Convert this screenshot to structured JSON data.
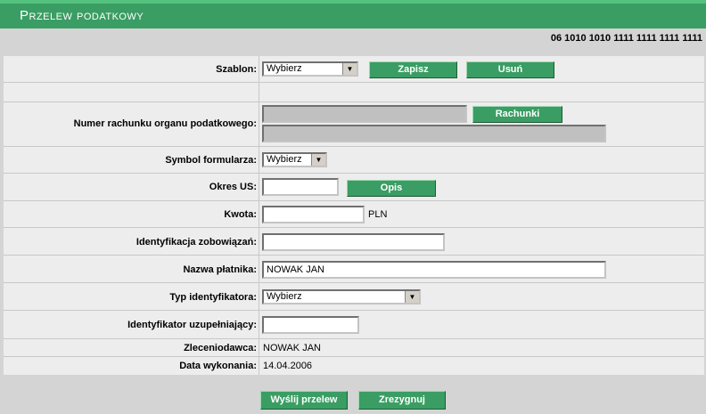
{
  "page_title": "Przelew podatkowy",
  "account_number": "06 1010 1010 1111 1111 1111 1111",
  "template": {
    "label": "Szablon:",
    "select_value": "Wybierz",
    "save_button": "Zapisz",
    "delete_button": "Usuń"
  },
  "tax_account": {
    "label": "Numer rachunku organu podatkowego:",
    "accounts_button": "Rachunki",
    "account_value": "",
    "name_value": ""
  },
  "form_symbol": {
    "label": "Symbol formularza:",
    "select_value": "Wybierz"
  },
  "period": {
    "label": "Okres US:",
    "value": "",
    "button": "Opis"
  },
  "amount": {
    "label": "Kwota:",
    "value": "",
    "currency": "PLN"
  },
  "obligation_id": {
    "label": "Identyfikacja zobowiązań:",
    "value": ""
  },
  "payer_name": {
    "label": "Nazwa płatnika:",
    "value": "NOWAK JAN"
  },
  "id_type": {
    "label": "Typ identyfikatora:",
    "select_value": "Wybierz"
  },
  "supplementary_id": {
    "label": "Identyfikator uzupełniający:",
    "value": ""
  },
  "ordering_party": {
    "label": "Zleceniodawca:",
    "value": "NOWAK JAN"
  },
  "execution_date": {
    "label": "Data wykonania:",
    "value": "14.04.2006"
  },
  "actions": {
    "send": "Wyślij przelew",
    "cancel": "Zrezygnuj"
  },
  "colors": {
    "accent": "#3a9d63",
    "accent_light": "#54c27e",
    "background": "#d4d4d4"
  }
}
